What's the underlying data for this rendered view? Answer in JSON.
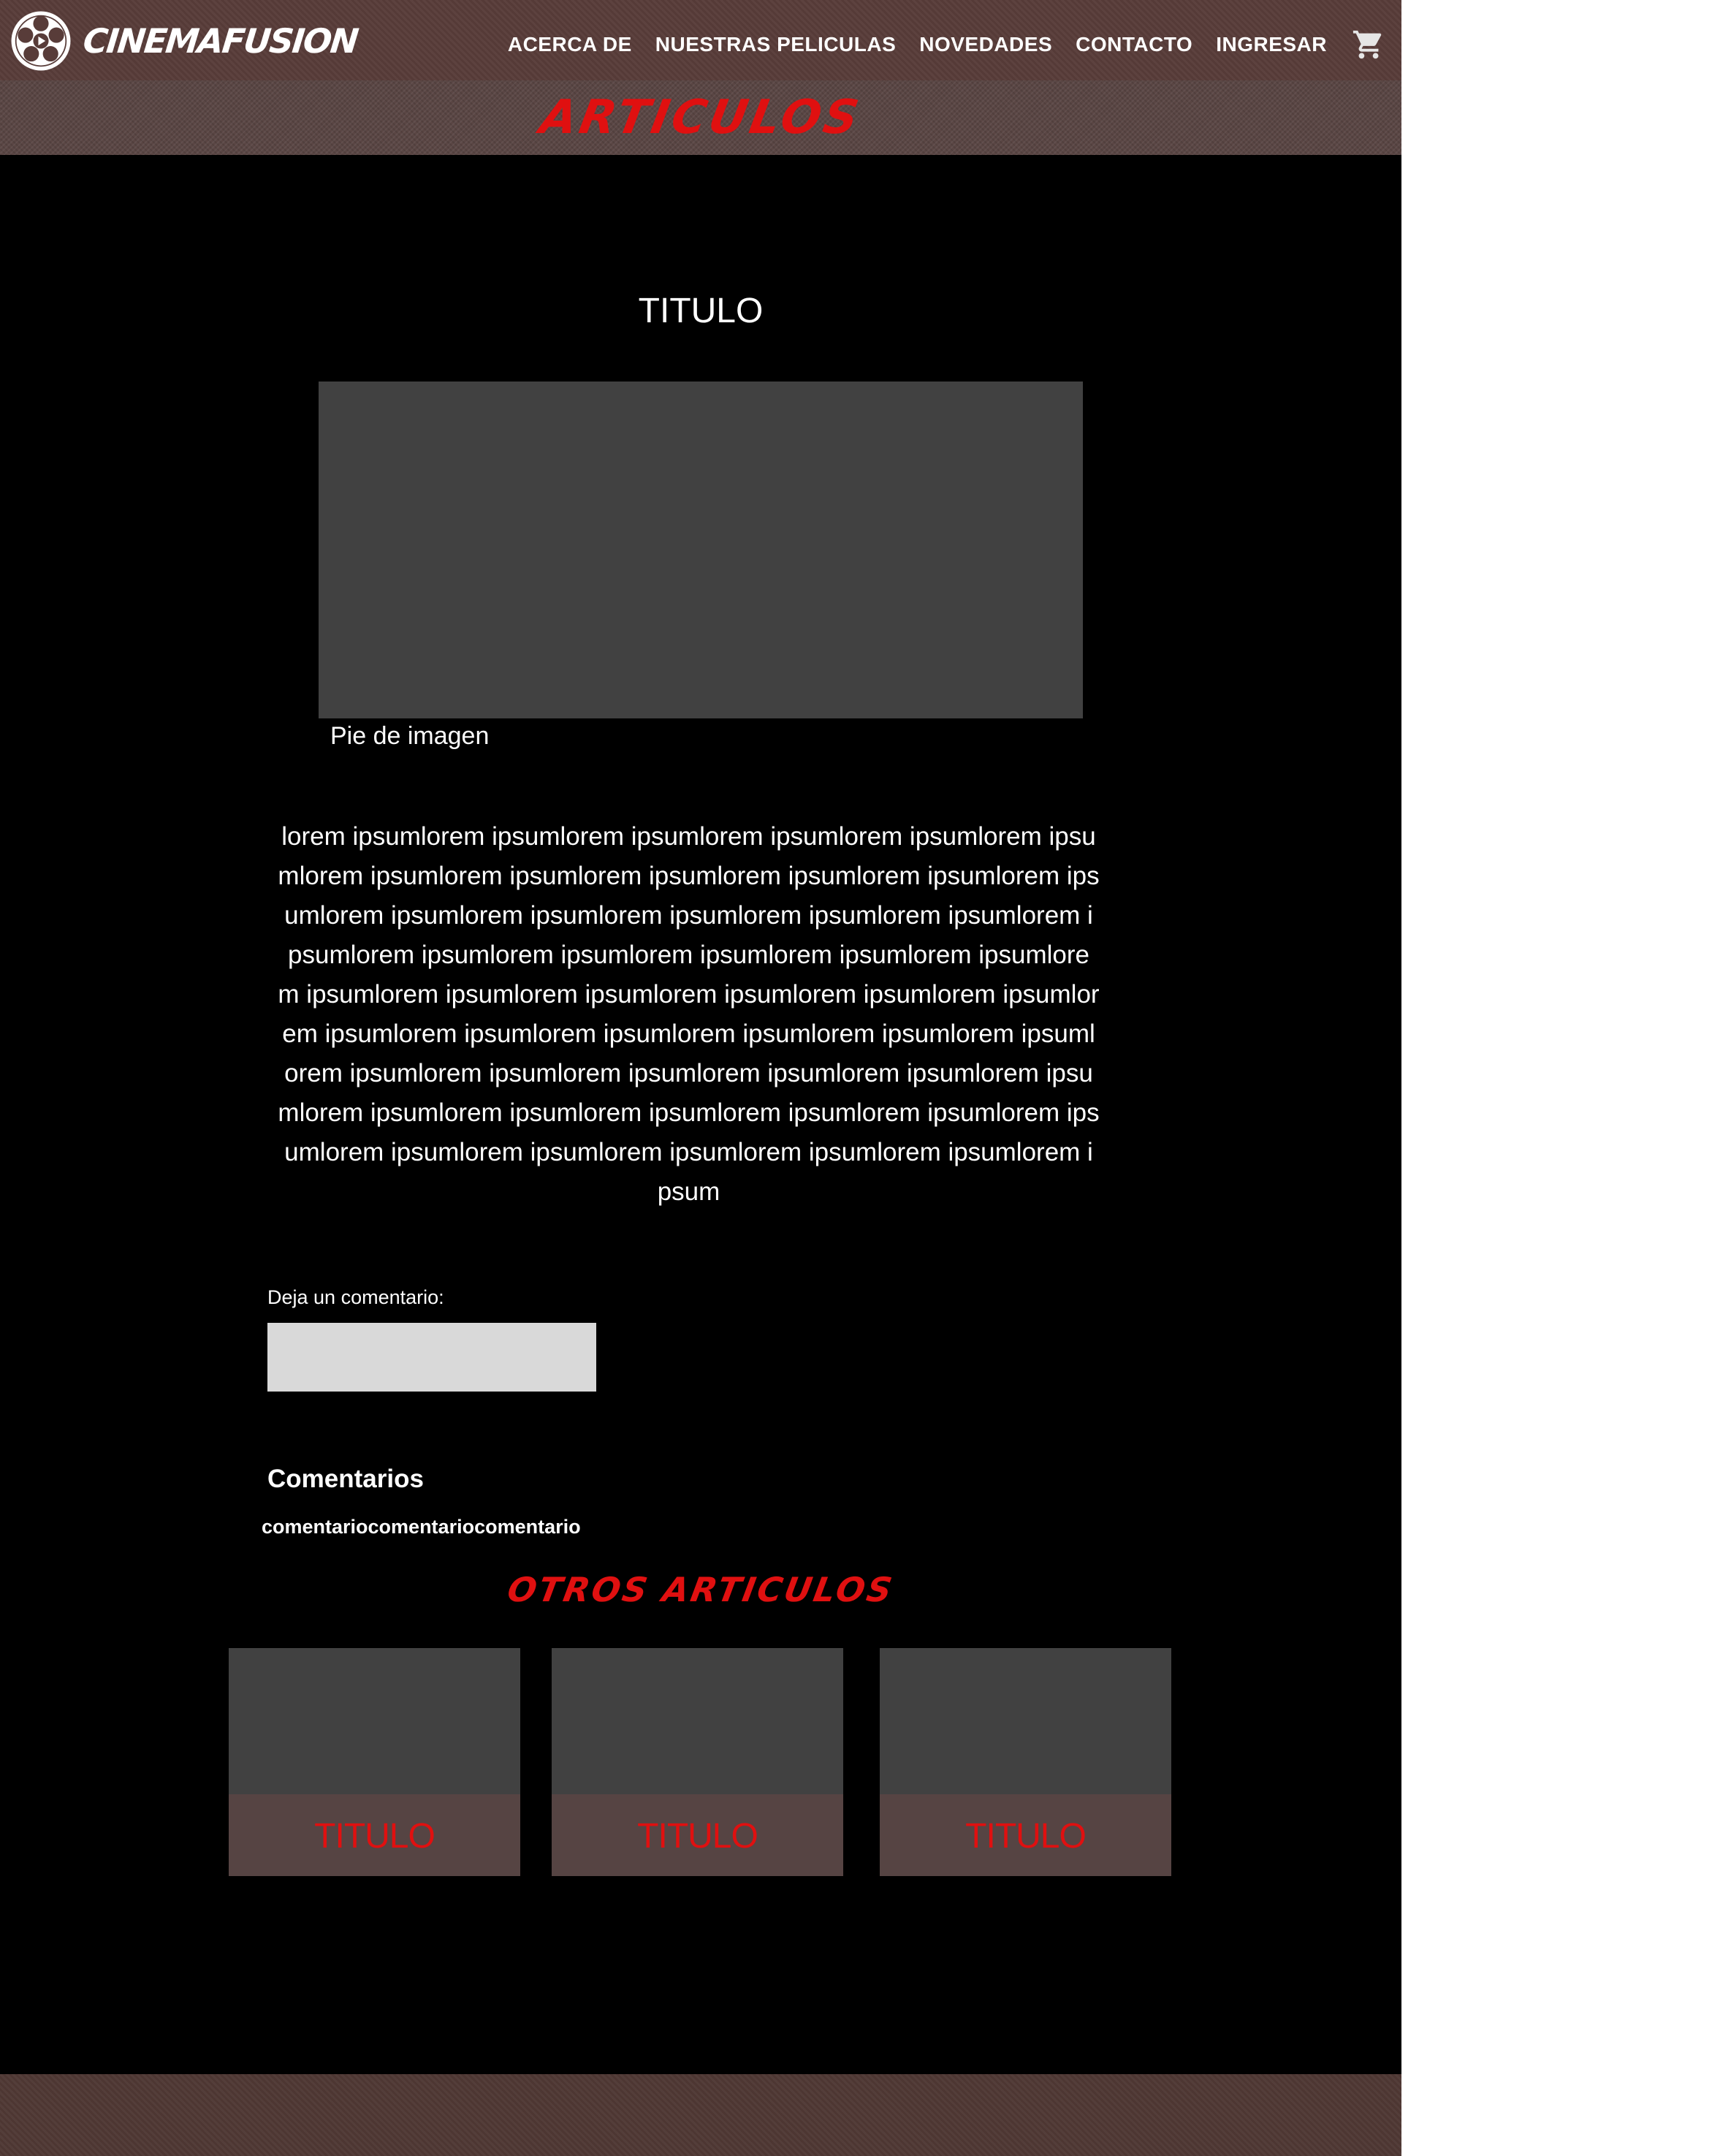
{
  "header": {
    "brand": "CINEMAFUSION",
    "logo_icon": "film-reel-icon",
    "nav": [
      {
        "label": "ACERCA DE"
      },
      {
        "label": "NUESTRAS PELICULAS"
      },
      {
        "label": "NOVEDADES"
      },
      {
        "label": "CONTACTO"
      },
      {
        "label": "INGRESAR"
      }
    ],
    "cart_icon": "shopping-cart-icon"
  },
  "banner": {
    "title": "ARTICULOS"
  },
  "article": {
    "title": "TITULO",
    "image_caption": "Pie de imagen",
    "body": "lorem ipsumlorem ipsumlorem ipsumlorem ipsumlorem ipsumlorem ipsumlorem ipsumlorem ipsumlorem ipsumlorem ipsumlorem ipsumlorem ipsumlorem ipsumlorem ipsumlorem ipsumlorem ipsumlorem ipsumlorem ipsumlorem ipsumlorem ipsumlorem ipsumlorem ipsumlorem ipsumlorem ipsumlorem ipsumlorem ipsumlorem ipsumlorem ipsumlorem ipsumlorem ipsumlorem ipsumlorem ipsumlorem ipsumlorem ipsumlorem ipsumlorem ipsumlorem ipsumlorem ipsumlorem ipsumlorem ipsumlorem ipsumlorem ipsumlorem ipsumlorem ipsumlorem ipsumlorem ipsumlorem ipsumlorem ipsumlorem ipsumlorem ipsumlorem ipsumlorem ipsumlorem ipsum"
  },
  "comment_form": {
    "label": "Deja un comentario:",
    "value": "",
    "placeholder": ""
  },
  "comments": {
    "heading": "Comentarios",
    "items": [
      {
        "text": "comentariocomentariocomentario"
      }
    ]
  },
  "other_articles": {
    "title": "OTROS ARTICULOS",
    "cards": [
      {
        "title": "TITULO"
      },
      {
        "title": "TITULO"
      },
      {
        "title": "TITULO"
      }
    ]
  },
  "colors": {
    "header_bg": "#583c39",
    "banner_bg": "#5a4644",
    "accent_red": "#e01010",
    "page_bg": "#000000",
    "placeholder_gray": "#414141",
    "input_bg": "#d9d9d9",
    "footer_bg": "#4f3834"
  }
}
